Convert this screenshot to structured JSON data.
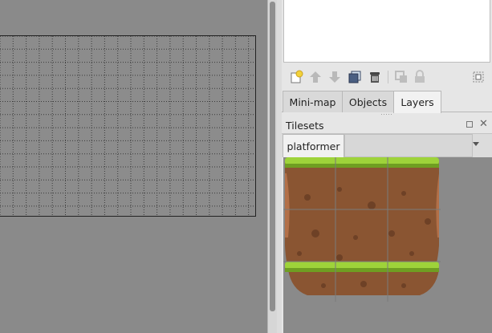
{
  "tabs": [
    {
      "label": "Mini-map"
    },
    {
      "label": "Objects"
    },
    {
      "label": "Layers"
    }
  ],
  "active_tab": "Layers",
  "tilesets": {
    "title": "Tilesets",
    "tab": "platformer"
  },
  "toolbar": {
    "icons": [
      "new-layer-icon",
      "move-layer-up-icon",
      "move-layer-down-icon",
      "duplicate-layer-icon",
      "delete-layer-icon",
      "group-layer-icon",
      "lock-icon",
      "highlight-current-layer-icon"
    ]
  },
  "colors": {
    "grass": "#9ed33a",
    "dirt": "#8a5532",
    "dirt_dark": "#6e4126",
    "canvas": "#8a8a8a"
  }
}
